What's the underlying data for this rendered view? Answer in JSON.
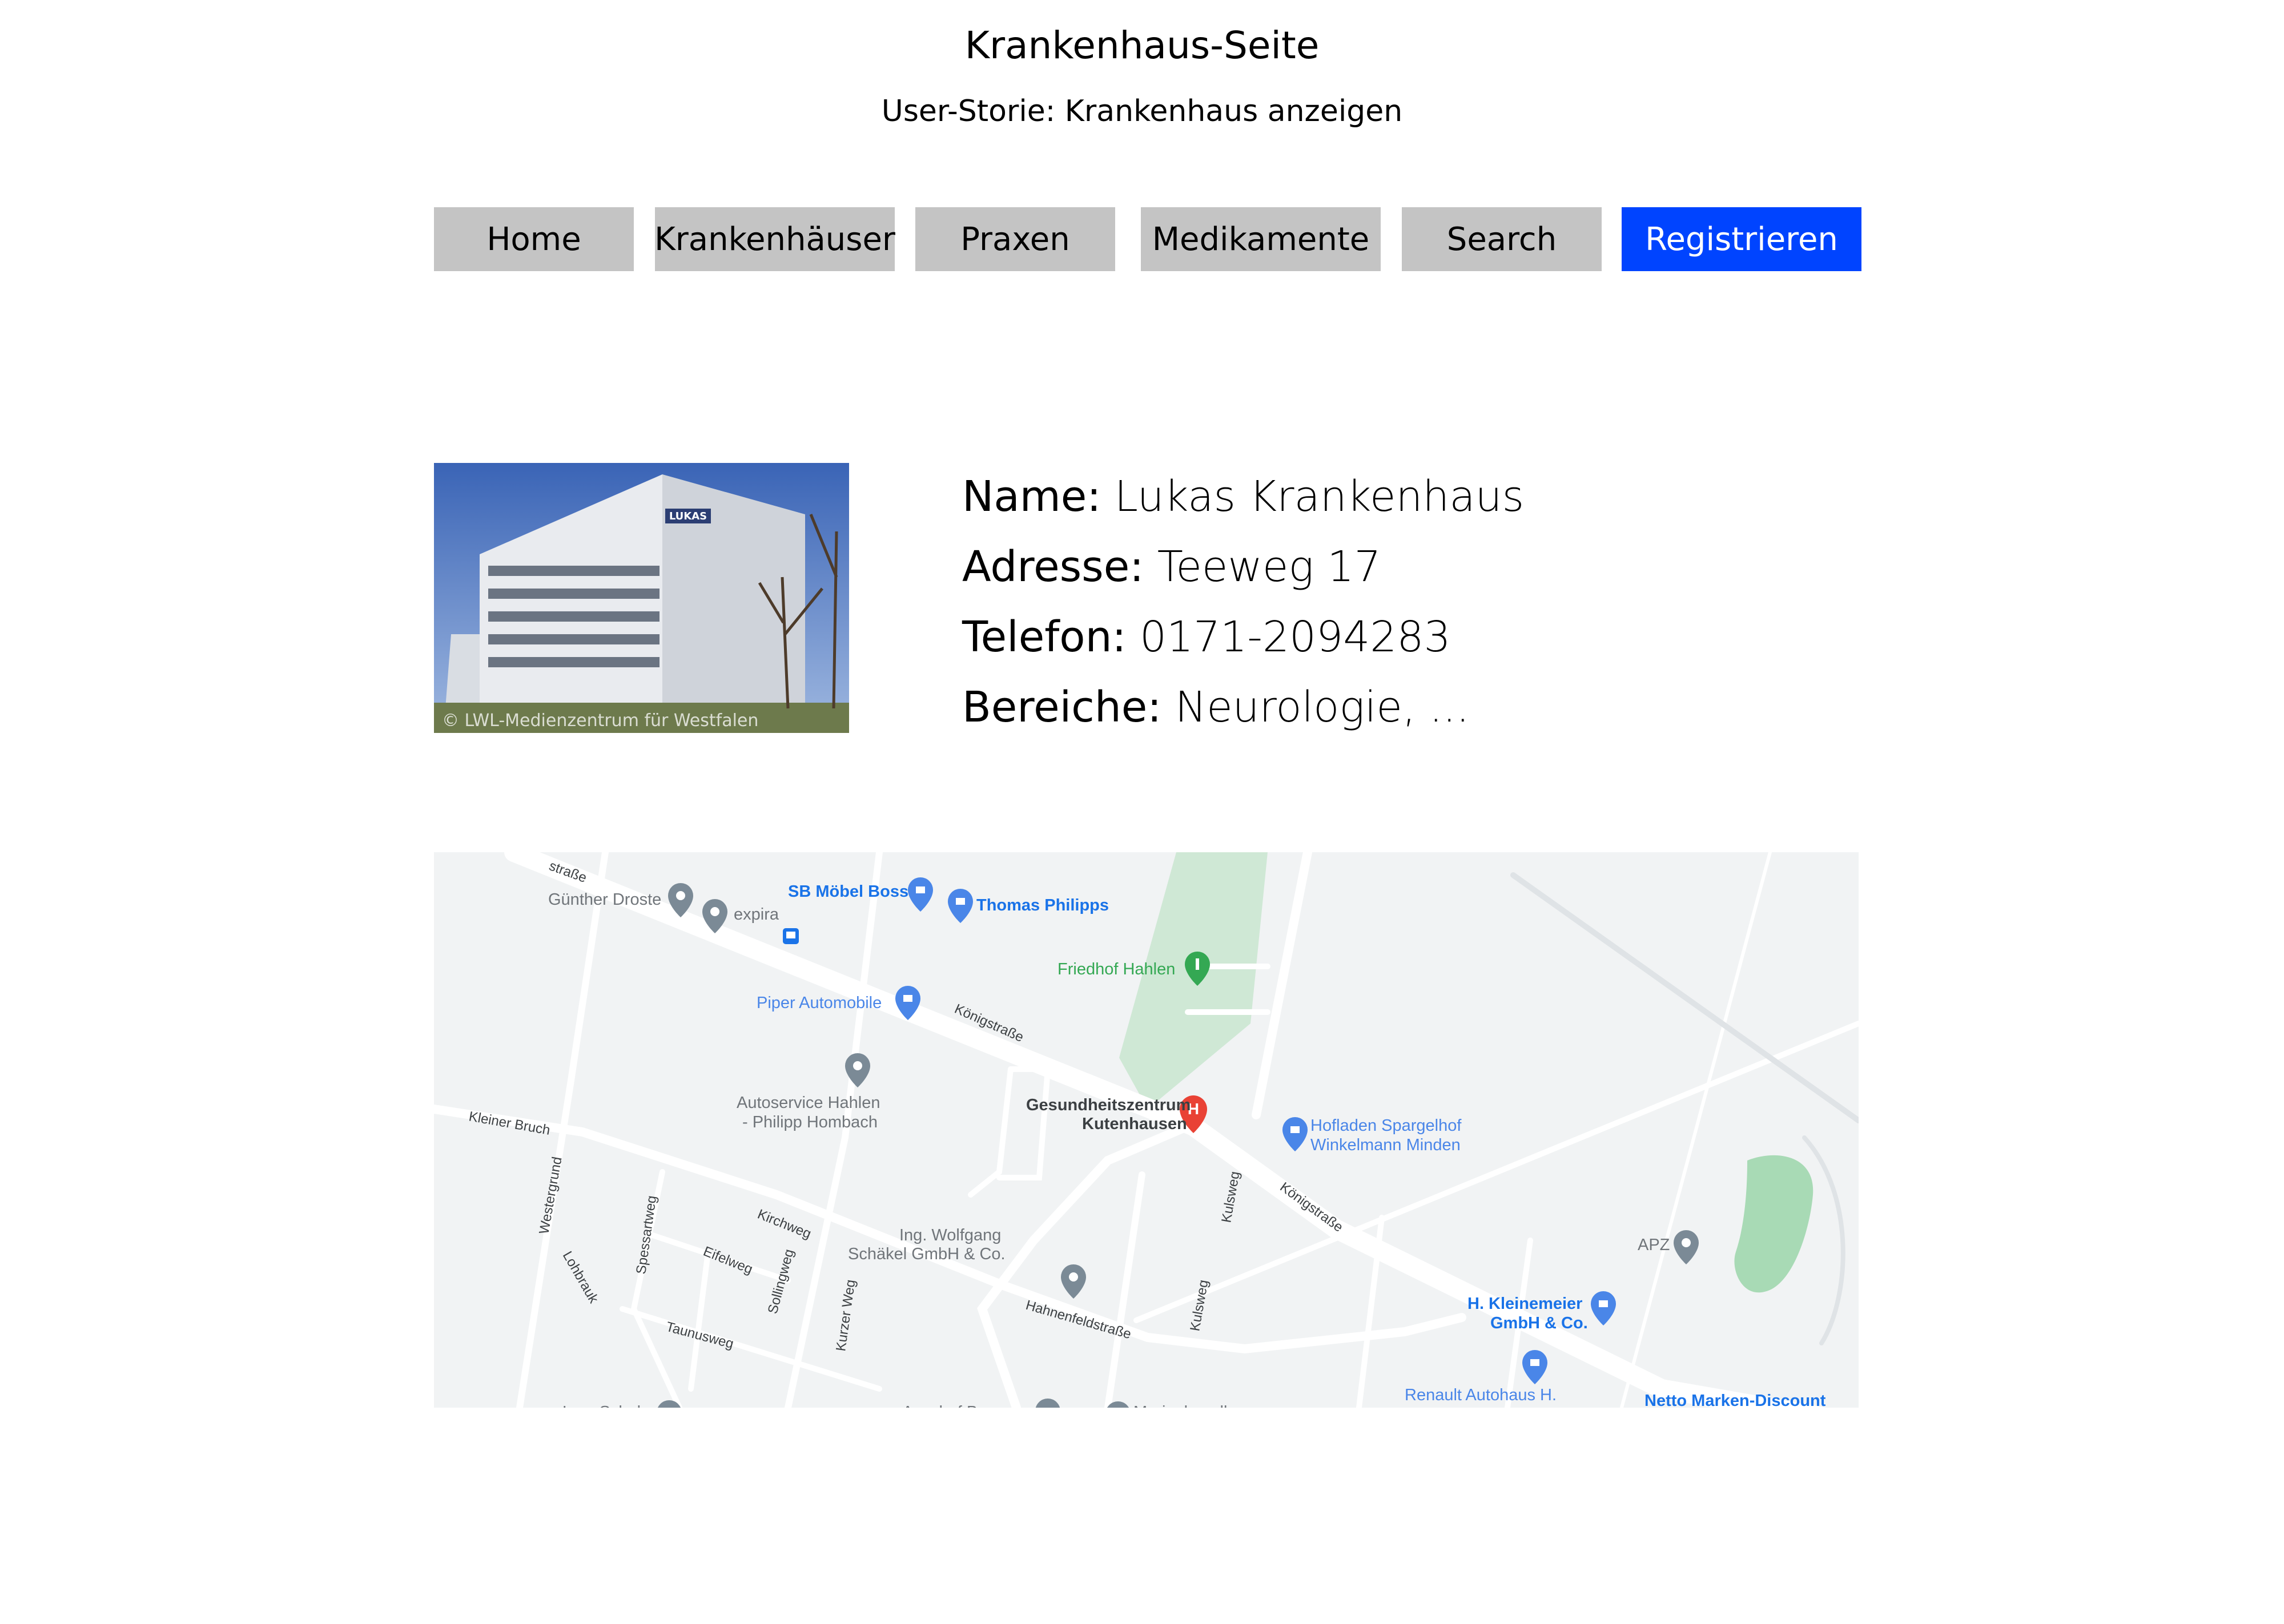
{
  "header": {
    "title": "Krankenhaus-Seite",
    "subtitle": "User-Storie: Krankenhaus anzeigen"
  },
  "nav": {
    "home": "Home",
    "hospitals": "Krankenhäuser",
    "practices": "Praxen",
    "medications": "Medikamente",
    "search": "Search",
    "register": "Registrieren"
  },
  "colors": {
    "nav_button": "#c4c4c4",
    "primary_button": "#0044ff",
    "map_background": "#f1f3f4",
    "map_green": "#cfe8d5",
    "poi_blue": "#4a86e8",
    "poi_gray": "#7b8a96",
    "hospital_red": "#e94235"
  },
  "hospital": {
    "photo_watermark": "© LWL-Medienzentrum für Westfalen",
    "building_sign": "LUKAS",
    "name_label": "Name:",
    "name_value": "Lukas Krankenhaus",
    "address_label": "Adresse:",
    "address_value": "Teeweg 17",
    "phone_label": "Telefon:",
    "phone_value": "0171-2094283",
    "departments_label": "Bereiche:",
    "departments_value": "Neurologie, ..."
  },
  "map": {
    "streets": {
      "top_left": "straße",
      "koenigstrasse_1": "Königstraße",
      "koenigstrasse_2": "Königstraße",
      "kleiner_bruch": "Kleiner Bruch",
      "westergrund": "Westergrund",
      "lohbrauk": "Lohbrauk",
      "spessartweg": "Spessartweg",
      "kirchweg": "Kirchweg",
      "eifelweg": "Eifelweg",
      "sollingweg": "Sollingweg",
      "taunusweg": "Taunusweg",
      "kurzer_weg": "Kurzer Weg",
      "hahnenfeldstrasse": "Hahnenfeldstraße",
      "kulsweg_1": "Kulsweg",
      "kulsweg_2": "Kulsweg"
    },
    "places": {
      "guenther_droste": "Günther Droste",
      "expira": "expira",
      "sb_moebel_boss": "SB Möbel Boss",
      "thomas_philipps": "Thomas Philipps",
      "friedhof_hahlen": "Friedhof Hahlen",
      "piper_automobile": "Piper Automobile",
      "autoservice_line1": "Autoservice Hahlen",
      "autoservice_line2": "- Philipp Hombach",
      "gesundheitszentrum_line1": "Gesundheitszentrum",
      "gesundheitszentrum_line2": "Kutenhausen",
      "hofladen_line1": "Hofladen Spargelhof",
      "hofladen_line2": "Winkelmann Minden",
      "schaekel_line1": "Ing. Wolfgang",
      "schaekel_line2": "Schäkel GmbH & Co.",
      "apz": "APZ",
      "kleinemeier_line1": "H. Kleinemeier",
      "kleinemeier_line2": "GmbH & Co.",
      "renault": "Renault Autohaus H.",
      "netto": "Netto Marken-Discount",
      "lars_schulz": "Lars Schulz",
      "marienkapelle": "Marienkapelle",
      "bottom_partial": "Anschaf B..."
    }
  }
}
